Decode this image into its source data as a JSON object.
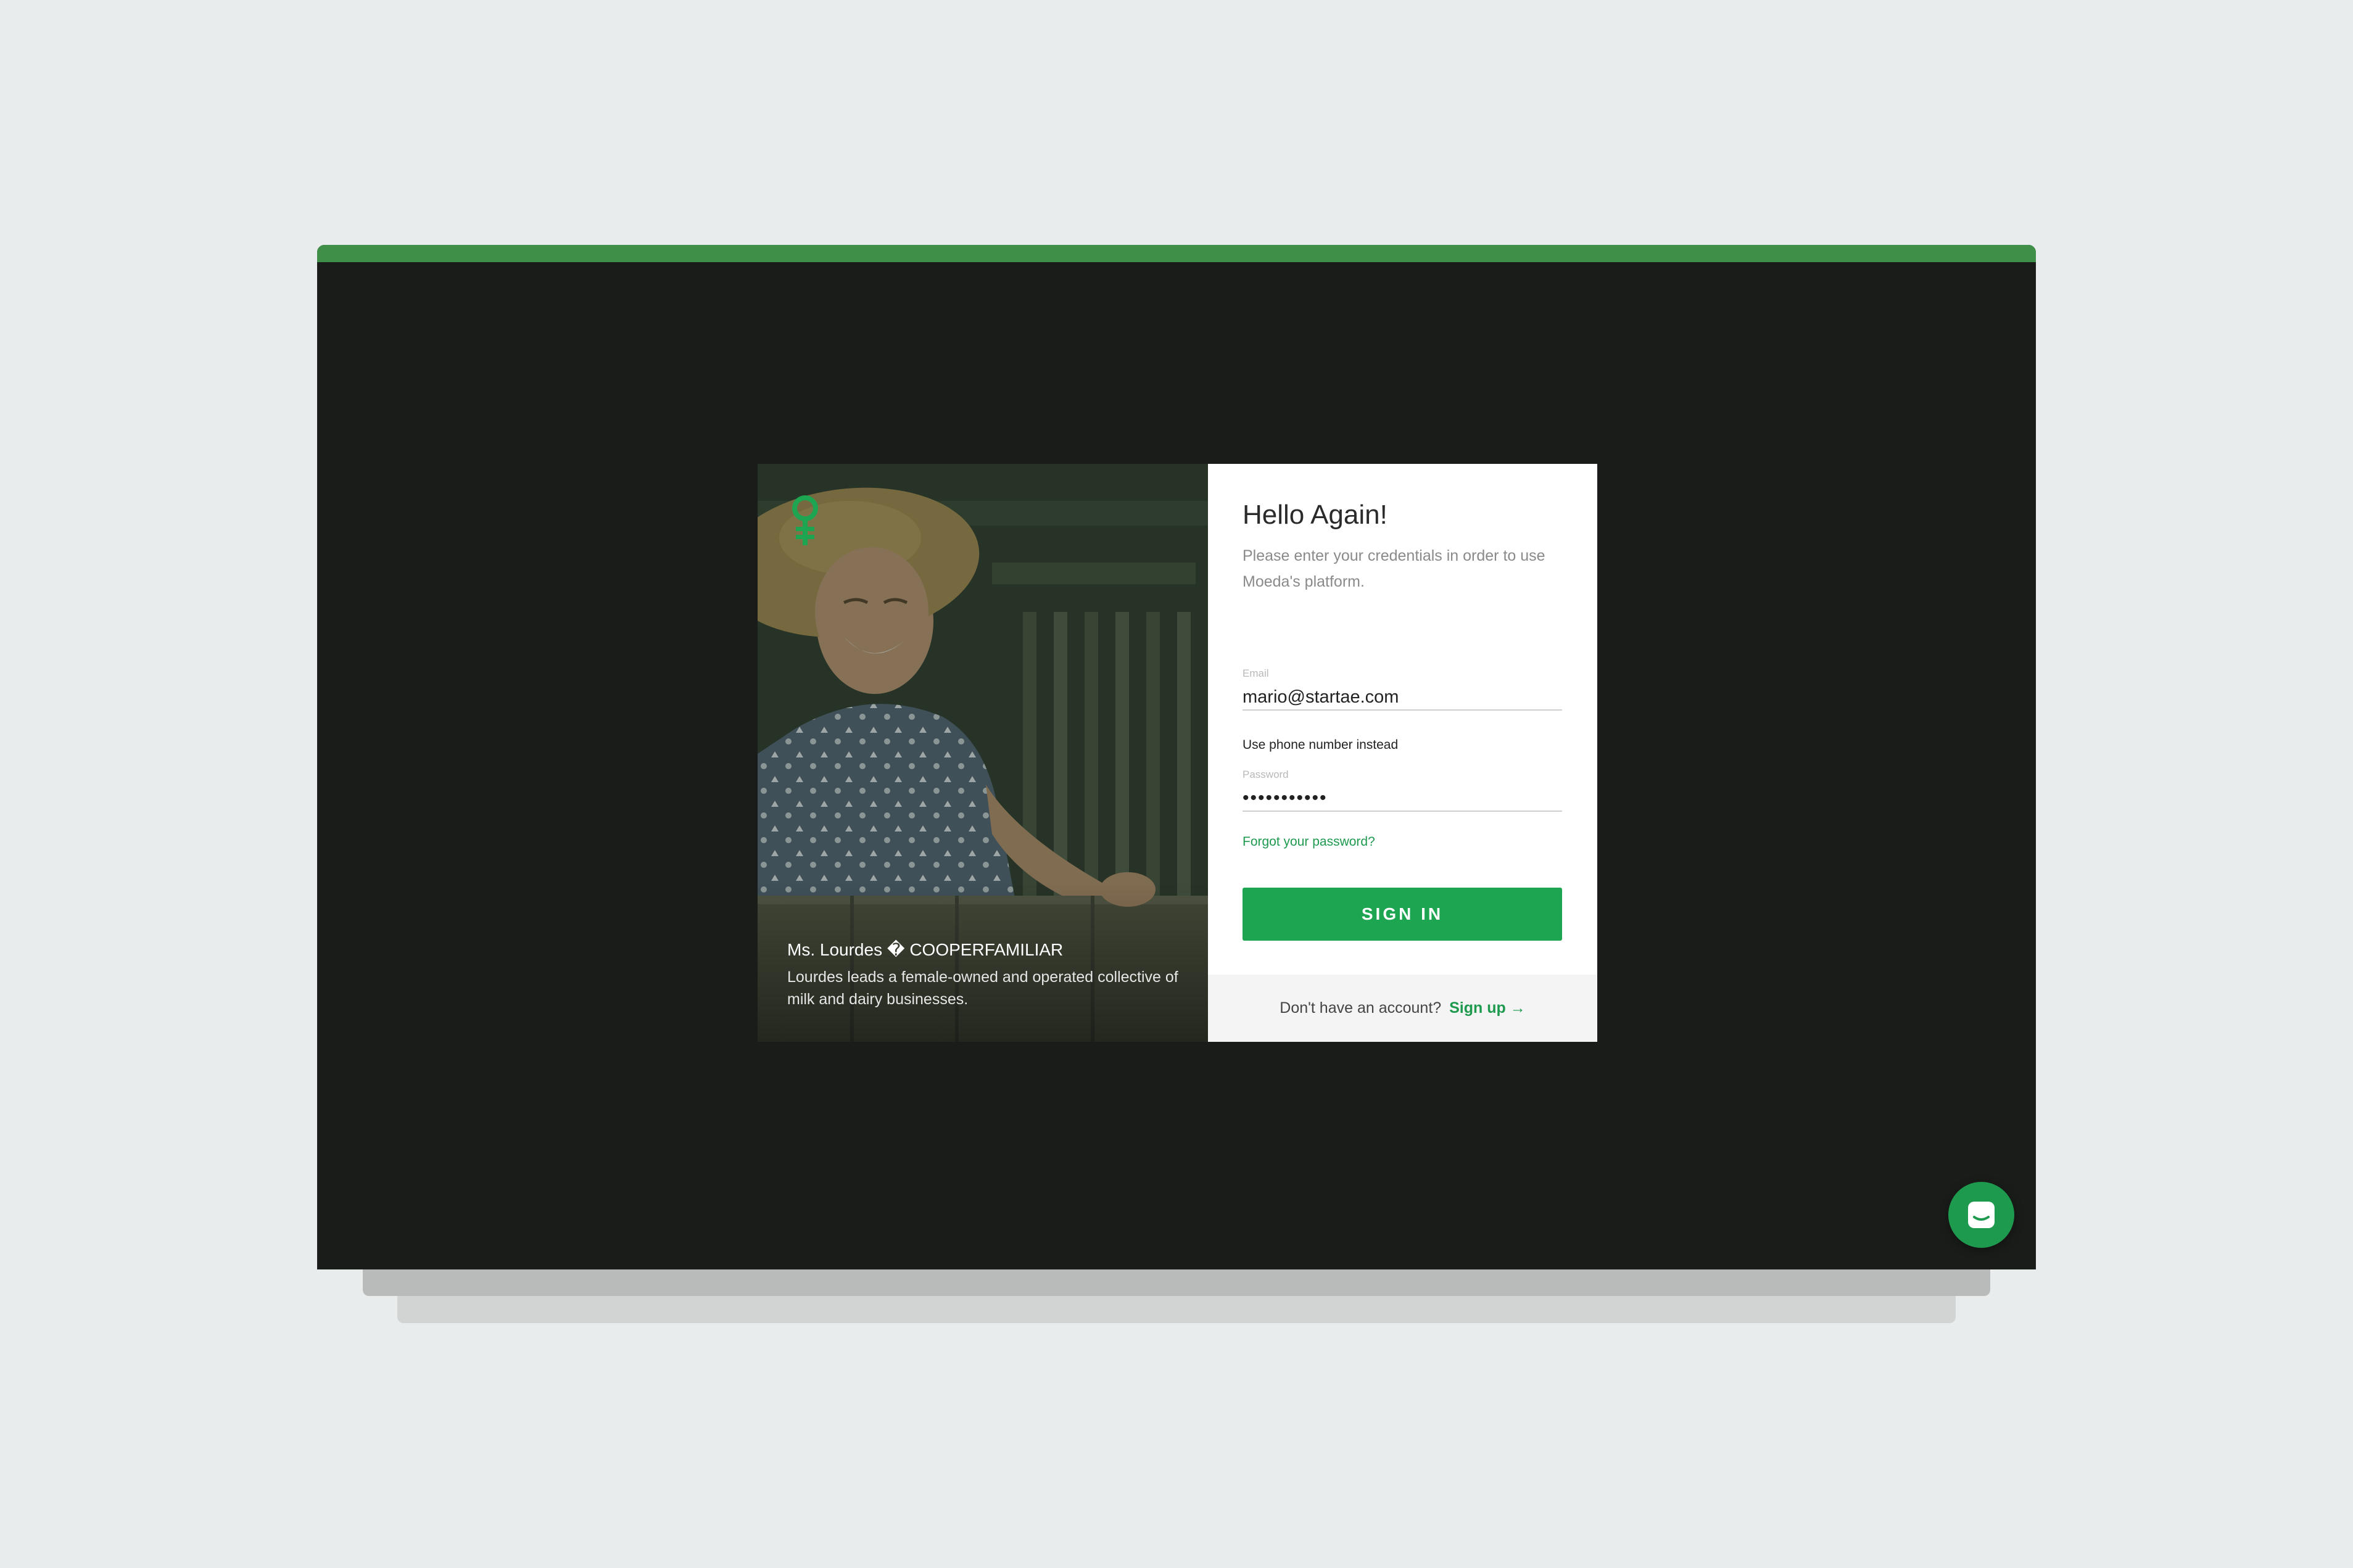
{
  "colors": {
    "background": "#e8ecec",
    "screen": "#1a1c1a",
    "topbar": "#3f8f48",
    "accent": "#1ea551",
    "link": "#1e9a4f"
  },
  "hero": {
    "caption_title": "Ms. Lourdes � COOPERFAMILIAR",
    "caption_desc": "Lourdes leads a female-owned and operated collective of milk and dairy businesses.",
    "logo_icon": "venus-symbol-icon"
  },
  "login": {
    "title": "Hello Again!",
    "subtitle": "Please enter your credentials in order to use Moeda's platform.",
    "email_label": "Email",
    "email_value": "mario@startae.com",
    "phone_link": "Use phone number instead",
    "password_label": "Password",
    "password_value": "ILovePlanet",
    "forgot_link": "Forgot your password?",
    "signin_label": "SIGN IN"
  },
  "footer": {
    "prompt": "Don't have an account?",
    "signup_label": "Sign up →"
  },
  "chat": {
    "icon": "chat-bubble-icon"
  }
}
